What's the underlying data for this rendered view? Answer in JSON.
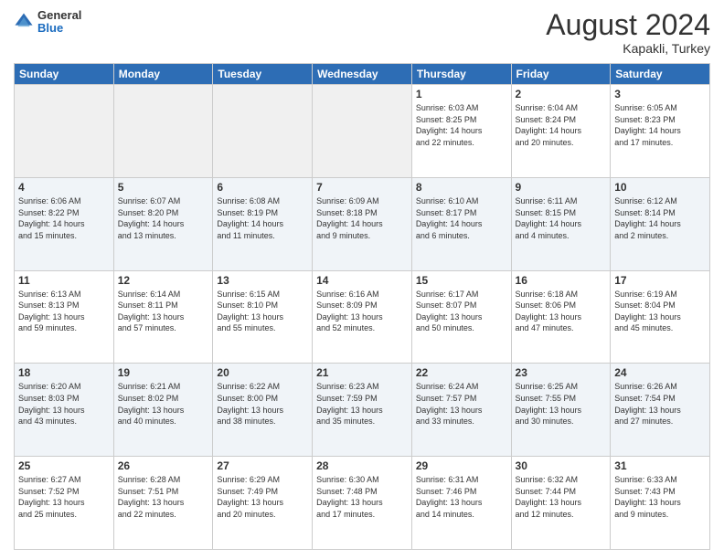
{
  "header": {
    "logo_line1": "General",
    "logo_line2": "Blue",
    "title": "August 2024",
    "subtitle": "Kapakli, Turkey"
  },
  "weekdays": [
    "Sunday",
    "Monday",
    "Tuesday",
    "Wednesday",
    "Thursday",
    "Friday",
    "Saturday"
  ],
  "weeks": [
    [
      {
        "day": "",
        "info": ""
      },
      {
        "day": "",
        "info": ""
      },
      {
        "day": "",
        "info": ""
      },
      {
        "day": "",
        "info": ""
      },
      {
        "day": "1",
        "info": "Sunrise: 6:03 AM\nSunset: 8:25 PM\nDaylight: 14 hours\nand 22 minutes."
      },
      {
        "day": "2",
        "info": "Sunrise: 6:04 AM\nSunset: 8:24 PM\nDaylight: 14 hours\nand 20 minutes."
      },
      {
        "day": "3",
        "info": "Sunrise: 6:05 AM\nSunset: 8:23 PM\nDaylight: 14 hours\nand 17 minutes."
      }
    ],
    [
      {
        "day": "4",
        "info": "Sunrise: 6:06 AM\nSunset: 8:22 PM\nDaylight: 14 hours\nand 15 minutes."
      },
      {
        "day": "5",
        "info": "Sunrise: 6:07 AM\nSunset: 8:20 PM\nDaylight: 14 hours\nand 13 minutes."
      },
      {
        "day": "6",
        "info": "Sunrise: 6:08 AM\nSunset: 8:19 PM\nDaylight: 14 hours\nand 11 minutes."
      },
      {
        "day": "7",
        "info": "Sunrise: 6:09 AM\nSunset: 8:18 PM\nDaylight: 14 hours\nand 9 minutes."
      },
      {
        "day": "8",
        "info": "Sunrise: 6:10 AM\nSunset: 8:17 PM\nDaylight: 14 hours\nand 6 minutes."
      },
      {
        "day": "9",
        "info": "Sunrise: 6:11 AM\nSunset: 8:15 PM\nDaylight: 14 hours\nand 4 minutes."
      },
      {
        "day": "10",
        "info": "Sunrise: 6:12 AM\nSunset: 8:14 PM\nDaylight: 14 hours\nand 2 minutes."
      }
    ],
    [
      {
        "day": "11",
        "info": "Sunrise: 6:13 AM\nSunset: 8:13 PM\nDaylight: 13 hours\nand 59 minutes."
      },
      {
        "day": "12",
        "info": "Sunrise: 6:14 AM\nSunset: 8:11 PM\nDaylight: 13 hours\nand 57 minutes."
      },
      {
        "day": "13",
        "info": "Sunrise: 6:15 AM\nSunset: 8:10 PM\nDaylight: 13 hours\nand 55 minutes."
      },
      {
        "day": "14",
        "info": "Sunrise: 6:16 AM\nSunset: 8:09 PM\nDaylight: 13 hours\nand 52 minutes."
      },
      {
        "day": "15",
        "info": "Sunrise: 6:17 AM\nSunset: 8:07 PM\nDaylight: 13 hours\nand 50 minutes."
      },
      {
        "day": "16",
        "info": "Sunrise: 6:18 AM\nSunset: 8:06 PM\nDaylight: 13 hours\nand 47 minutes."
      },
      {
        "day": "17",
        "info": "Sunrise: 6:19 AM\nSunset: 8:04 PM\nDaylight: 13 hours\nand 45 minutes."
      }
    ],
    [
      {
        "day": "18",
        "info": "Sunrise: 6:20 AM\nSunset: 8:03 PM\nDaylight: 13 hours\nand 43 minutes."
      },
      {
        "day": "19",
        "info": "Sunrise: 6:21 AM\nSunset: 8:02 PM\nDaylight: 13 hours\nand 40 minutes."
      },
      {
        "day": "20",
        "info": "Sunrise: 6:22 AM\nSunset: 8:00 PM\nDaylight: 13 hours\nand 38 minutes."
      },
      {
        "day": "21",
        "info": "Sunrise: 6:23 AM\nSunset: 7:59 PM\nDaylight: 13 hours\nand 35 minutes."
      },
      {
        "day": "22",
        "info": "Sunrise: 6:24 AM\nSunset: 7:57 PM\nDaylight: 13 hours\nand 33 minutes."
      },
      {
        "day": "23",
        "info": "Sunrise: 6:25 AM\nSunset: 7:55 PM\nDaylight: 13 hours\nand 30 minutes."
      },
      {
        "day": "24",
        "info": "Sunrise: 6:26 AM\nSunset: 7:54 PM\nDaylight: 13 hours\nand 27 minutes."
      }
    ],
    [
      {
        "day": "25",
        "info": "Sunrise: 6:27 AM\nSunset: 7:52 PM\nDaylight: 13 hours\nand 25 minutes."
      },
      {
        "day": "26",
        "info": "Sunrise: 6:28 AM\nSunset: 7:51 PM\nDaylight: 13 hours\nand 22 minutes."
      },
      {
        "day": "27",
        "info": "Sunrise: 6:29 AM\nSunset: 7:49 PM\nDaylight: 13 hours\nand 20 minutes."
      },
      {
        "day": "28",
        "info": "Sunrise: 6:30 AM\nSunset: 7:48 PM\nDaylight: 13 hours\nand 17 minutes."
      },
      {
        "day": "29",
        "info": "Sunrise: 6:31 AM\nSunset: 7:46 PM\nDaylight: 13 hours\nand 14 minutes."
      },
      {
        "day": "30",
        "info": "Sunrise: 6:32 AM\nSunset: 7:44 PM\nDaylight: 13 hours\nand 12 minutes."
      },
      {
        "day": "31",
        "info": "Sunrise: 6:33 AM\nSunset: 7:43 PM\nDaylight: 13 hours\nand 9 minutes."
      }
    ]
  ]
}
